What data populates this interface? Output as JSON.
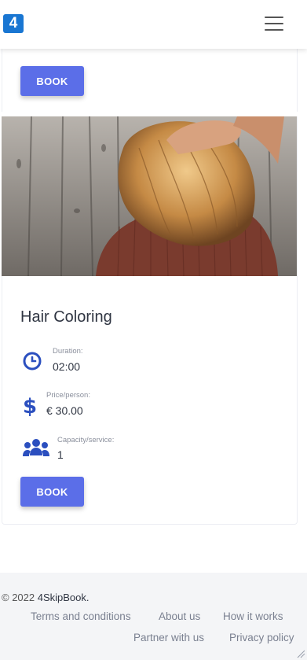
{
  "header": {
    "logo_text": "4",
    "menu_icon": "hamburger-icon"
  },
  "services": [
    {
      "book_label": "BOOK"
    },
    {
      "title": "Hair Coloring",
      "duration_label": "Duration:",
      "duration_value": "02:00",
      "price_label": "Price/person:",
      "price_value": "€ 30.00",
      "capacity_label": "Capacity/service:",
      "capacity_value": "1",
      "book_label": "BOOK",
      "icons": [
        "clock-icon",
        "dollar-icon",
        "users-icon"
      ]
    }
  ],
  "footer": {
    "copyright_prefix": "© 2022 ",
    "brand": "4SkipBook.",
    "links": [
      "Terms and conditions",
      "About us",
      "How it works",
      "Partner with us",
      "Privacy policy"
    ]
  },
  "colors": {
    "accent": "#5b6ee8",
    "icon": "#2b4fbf",
    "footer_bg": "#f4f5f7"
  }
}
